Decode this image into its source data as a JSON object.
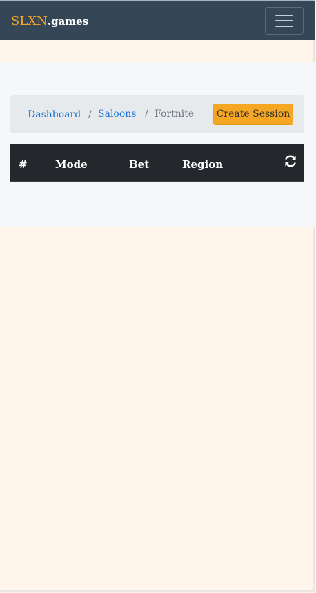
{
  "navbar": {
    "brand_main": "SLXN",
    "brand_sub": ".games",
    "toggle_icon": "hamburger-menu-icon"
  },
  "breadcrumb": {
    "items": [
      {
        "label": "Dashboard",
        "link": true
      },
      {
        "label": "Saloons",
        "link": true
      },
      {
        "label": "Fortnite",
        "link": false
      }
    ],
    "separator": "/"
  },
  "actions": {
    "create_session_label": "Create Session"
  },
  "table": {
    "columns": [
      "#",
      "Mode",
      "Bet",
      "Region"
    ],
    "refresh_icon": "refresh-icon",
    "rows": []
  },
  "colors": {
    "accent": "#f5a623",
    "navbar": "#354756",
    "link": "#1a73d1",
    "table_header": "#24272b",
    "page_background": "#fff5ea"
  }
}
